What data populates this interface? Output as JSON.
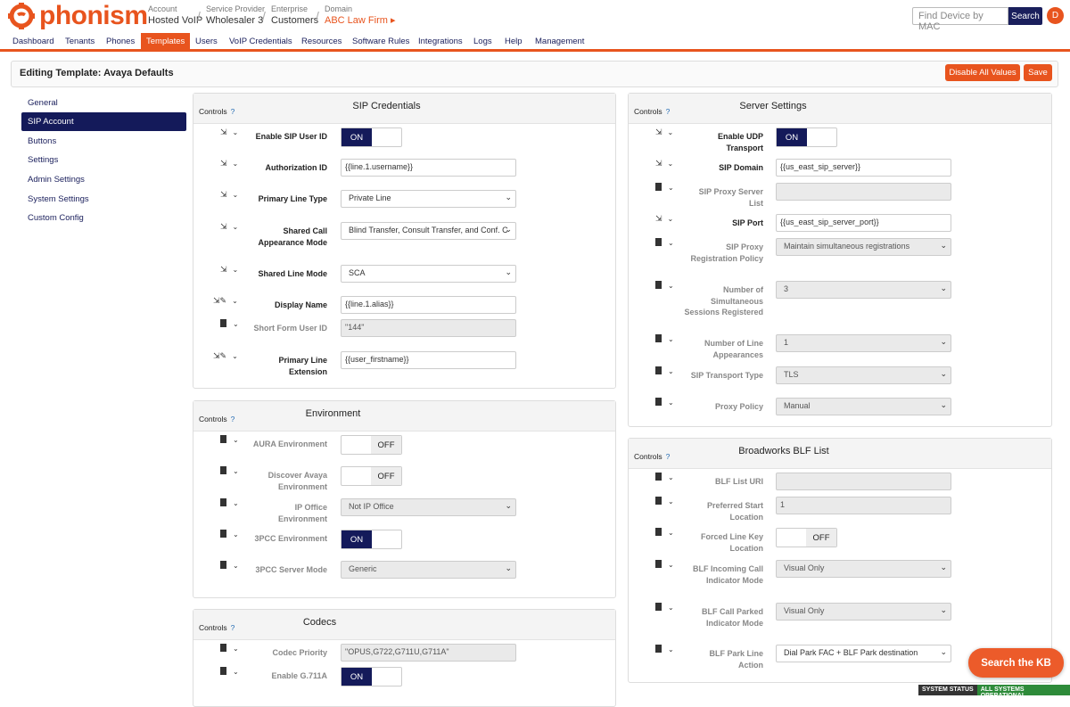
{
  "brand": {
    "logo_text": "phonism",
    "color": "#e8541e"
  },
  "breadcrumb": [
    {
      "small": "Account",
      "large": "Hosted VoIP"
    },
    {
      "small": "Service Provider",
      "large": "Wholesaler 3"
    },
    {
      "small": "Enterprise",
      "large": "Customers"
    },
    {
      "small": "Domain",
      "large": "ABC Law Firm ▸"
    }
  ],
  "search": {
    "placeholder": "Find Device by MAC",
    "button": "Search"
  },
  "user": {
    "initial": "D"
  },
  "nav": [
    "Dashboard",
    "Tenants",
    "Phones",
    "Templates",
    "Users",
    "VoIP Credentials",
    "Resources",
    "Software Rules",
    "Integrations",
    "Logs",
    "Help",
    "Management"
  ],
  "nav_active": "Templates",
  "editbar": {
    "title": "Editing Template: Avaya Defaults",
    "disable_all": "Disable All Values",
    "save": "Save"
  },
  "sidenav": [
    "General",
    "SIP Account",
    "Buttons",
    "Settings",
    "Admin Settings",
    "System Settings",
    "Custom Config"
  ],
  "sidenav_active": "SIP Account",
  "controls_label": "Controls",
  "help_mark": "?",
  "sip_credentials": {
    "title": "SIP Credentials",
    "fields": [
      {
        "label": "Enable SIP User ID",
        "type": "toggle",
        "value": "ON"
      },
      {
        "label": "Authorization ID",
        "type": "input",
        "value": "{{line.1.username}}"
      },
      {
        "label": "Primary Line Type",
        "type": "select",
        "value": "Private Line"
      },
      {
        "label": "Shared Call Appearance Mode",
        "type": "select",
        "value": "Blind Transfer, Consult Transfer, and Conf. C"
      },
      {
        "label": "Shared Line Mode",
        "type": "select",
        "value": "SCA"
      },
      {
        "label": "Display Name",
        "type": "input",
        "value": "{{line.1.alias}}"
      },
      {
        "label": "Short Form User ID",
        "type": "input-ro",
        "value": "\"144\""
      },
      {
        "label": "Primary Line Extension",
        "type": "input",
        "value": "{{user_firstname}}"
      }
    ]
  },
  "environment": {
    "title": "Environment",
    "fields": [
      {
        "label": "AURA Environment",
        "type": "toggle",
        "value": "OFF"
      },
      {
        "label": "Discover Avaya Environment",
        "type": "toggle",
        "value": "OFF"
      },
      {
        "label": "IP Office Environment",
        "type": "select",
        "value": "Not IP Office"
      },
      {
        "label": "3PCC Environment",
        "type": "toggle",
        "value": "ON"
      },
      {
        "label": "3PCC Server Mode",
        "type": "select",
        "value": "Generic"
      }
    ]
  },
  "codecs": {
    "title": "Codecs",
    "fields": [
      {
        "label": "Codec Priority",
        "type": "input-ro",
        "value": "\"OPUS,G722,G711U,G711A\""
      },
      {
        "label": "Enable G.711A",
        "type": "toggle",
        "value": "ON"
      }
    ]
  },
  "server_settings": {
    "title": "Server Settings",
    "fields": [
      {
        "label": "Enable UDP Transport",
        "type": "toggle",
        "value": "ON"
      },
      {
        "label": "SIP Domain",
        "type": "input",
        "value": "{{us_east_sip_server}}"
      },
      {
        "label": "SIP Proxy Server List",
        "type": "input-ro",
        "value": ""
      },
      {
        "label": "SIP Port",
        "type": "input",
        "value": "{{us_east_sip_server_port}}"
      },
      {
        "label": "SIP Proxy Registration Policy",
        "type": "select",
        "value": "Maintain simultaneous registrations"
      },
      {
        "label": "Number of Simultaneous Sessions Registered",
        "type": "select",
        "value": "3"
      },
      {
        "label": "Number of Line Appearances",
        "type": "select",
        "value": "1"
      },
      {
        "label": "SIP Transport Type",
        "type": "select",
        "value": "TLS"
      },
      {
        "label": "Proxy Policy",
        "type": "select",
        "value": "Manual"
      }
    ]
  },
  "blf": {
    "title": "Broadworks BLF List",
    "fields": [
      {
        "label": "BLF List URI",
        "type": "input-ro",
        "value": ""
      },
      {
        "label": "Preferred Start Location",
        "type": "input-ro",
        "value": "1"
      },
      {
        "label": "Forced Line Key Location",
        "type": "toggle",
        "value": "OFF"
      },
      {
        "label": "BLF Incoming Call Indicator Mode",
        "type": "select",
        "value": "Visual Only"
      },
      {
        "label": "BLF Call Parked Indicator Mode",
        "type": "select",
        "value": "Visual Only"
      },
      {
        "label": "BLF Park Line Action",
        "type": "select",
        "value": "Dial Park FAC + BLF Park destination"
      }
    ]
  },
  "kb_button": "Search the KB",
  "status": {
    "label": "SYSTEM STATUS",
    "value": "ALL SYSTEMS OPERATIONAL"
  }
}
